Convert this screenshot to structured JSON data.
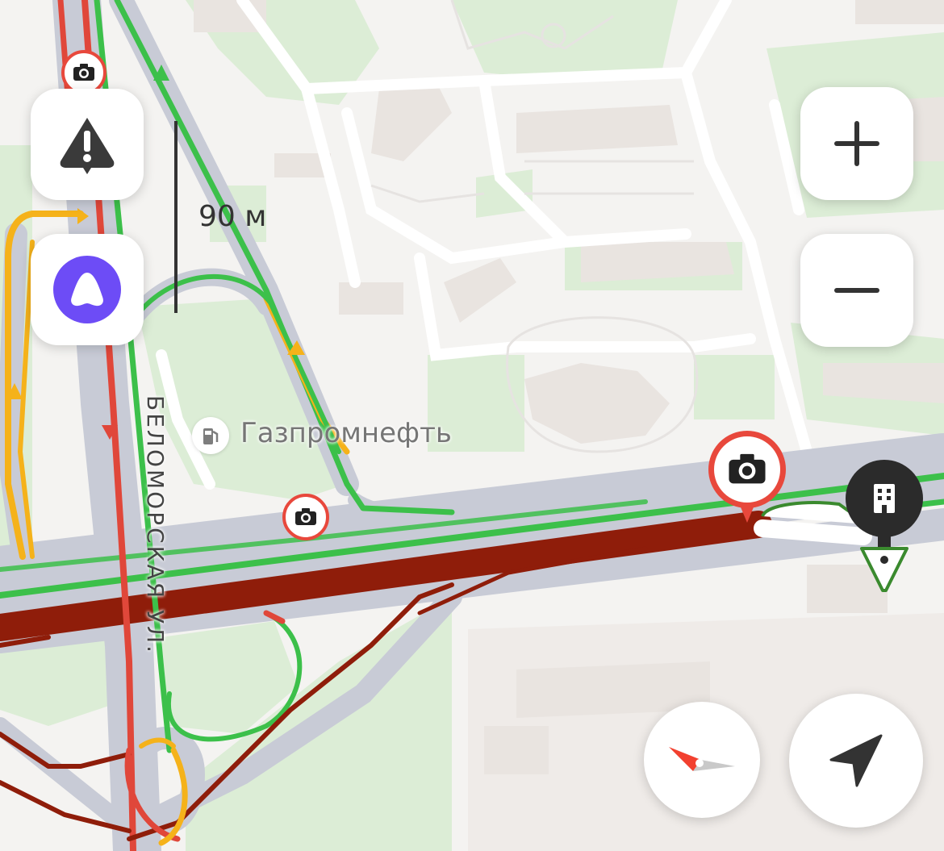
{
  "map": {
    "scale_label": "90 м",
    "poi": {
      "name": "Газпромнефть",
      "icon": "fuel-station-icon"
    },
    "street": "БЕЛОМОРСКАЯ УЛ.",
    "traffic_colors": {
      "free": "#3cc04a",
      "slow": "#f5b21a",
      "heavy": "#e0473a",
      "jam": "#8f1d0a"
    }
  },
  "controls": {
    "report_incident": {
      "icon": "warning-icon"
    },
    "voice_assistant": {
      "icon": "alice-icon",
      "color": "#6d4cf6"
    },
    "zoom_in": {
      "icon": "plus-icon"
    },
    "zoom_out": {
      "icon": "minus-icon"
    },
    "compass": {
      "icon": "compass-icon"
    },
    "my_location": {
      "icon": "navigation-arrow-icon"
    }
  },
  "markers": {
    "speed_cameras": [
      "camera-icon",
      "camera-icon",
      "camera-icon"
    ],
    "building": {
      "icon": "building-icon"
    },
    "destination": {
      "icon": "destination-pin-icon"
    }
  }
}
